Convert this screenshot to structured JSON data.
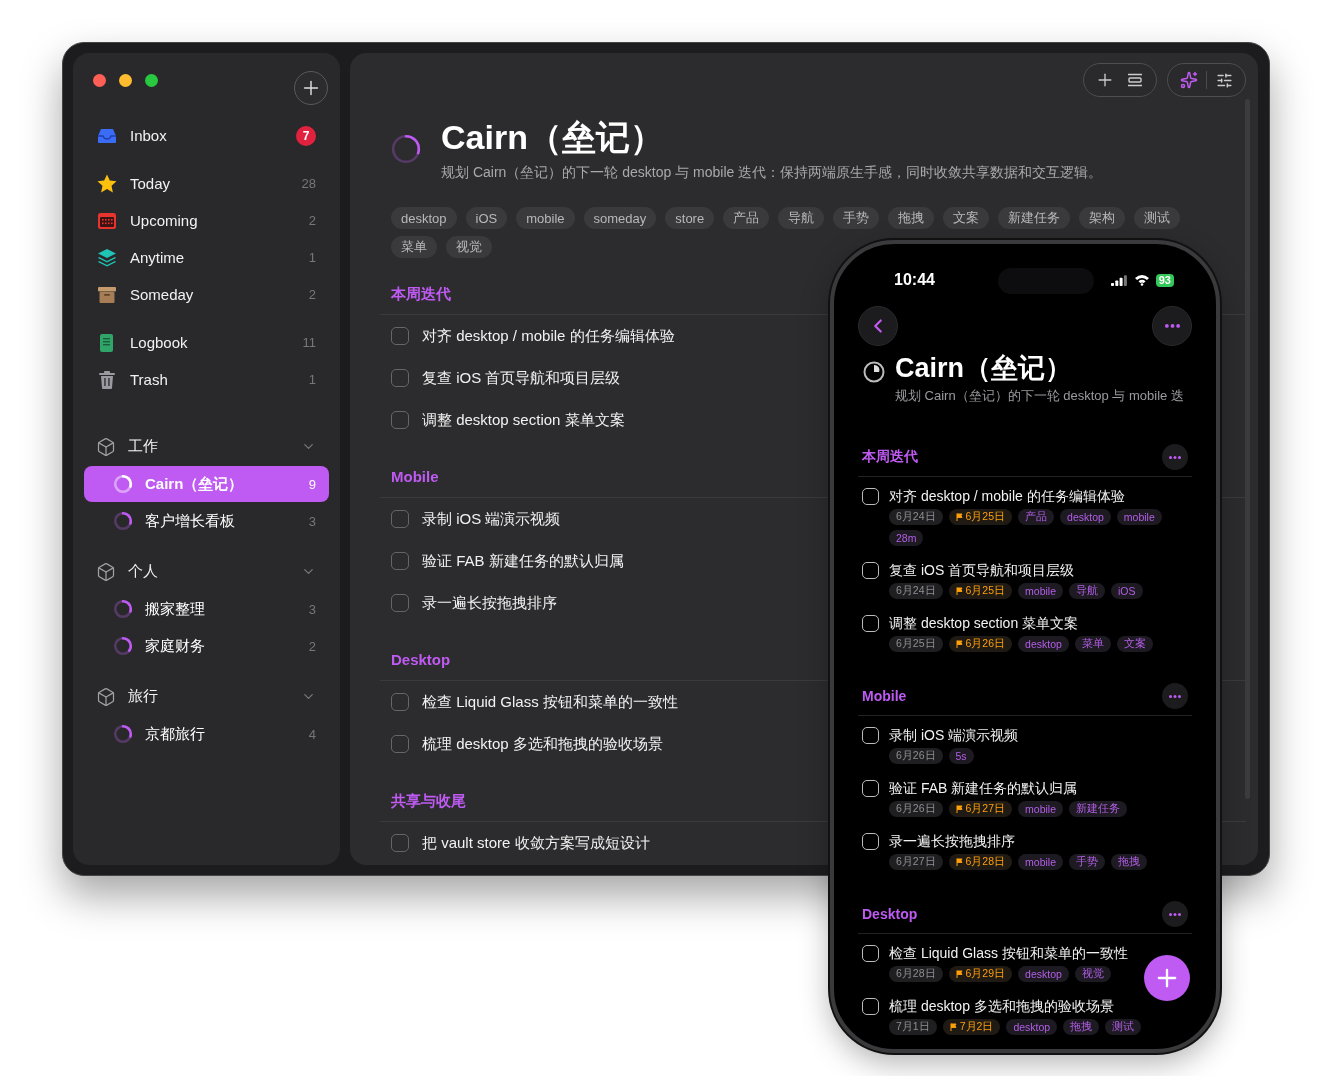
{
  "sidebar": {
    "items": [
      {
        "kind": "inbox",
        "label": "Inbox",
        "count": "7",
        "badge": true
      },
      {
        "kind": "today",
        "label": "Today",
        "count": "28",
        "badge": false
      },
      {
        "kind": "upcoming",
        "label": "Upcoming",
        "count": "2",
        "badge": false
      },
      {
        "kind": "anytime",
        "label": "Anytime",
        "count": "1",
        "badge": false
      },
      {
        "kind": "someday",
        "label": "Someday",
        "count": "2",
        "badge": false
      },
      {
        "kind": "logbook",
        "label": "Logbook",
        "count": "11",
        "badge": false
      },
      {
        "kind": "trash",
        "label": "Trash",
        "count": "1",
        "badge": false
      }
    ],
    "areas": [
      {
        "name": "工作",
        "expanded": true,
        "projects": [
          {
            "name": "Cairn（垒记）",
            "count": "9",
            "selected": true,
            "level": 0.3
          },
          {
            "name": "客户增长看板",
            "count": "3",
            "selected": false,
            "level": 0.3
          }
        ]
      },
      {
        "name": "个人",
        "expanded": true,
        "projects": [
          {
            "name": "搬家整理",
            "count": "3",
            "selected": false,
            "level": 0.3
          },
          {
            "name": "家庭财务",
            "count": "2",
            "selected": false,
            "level": 0.35
          }
        ]
      },
      {
        "name": "旅行",
        "expanded": true,
        "projects": [
          {
            "name": "京都旅行",
            "count": "4",
            "selected": false,
            "level": 0.3
          }
        ]
      }
    ]
  },
  "main": {
    "title": "Cairn（垒记）",
    "level": 0.3,
    "subtitle": "规划 Cairn（垒记）的下一轮 desktop 与 mobile 迭代：保持两端原生手感，同时收敛共享数据和交互逻辑。",
    "tags": [
      "desktop",
      "iOS",
      "mobile",
      "someday",
      "store",
      "产品",
      "导航",
      "手势",
      "拖拽",
      "文案",
      "新建任务",
      "架构",
      "测试",
      "菜单",
      "视觉"
    ],
    "sections": [
      {
        "title": "本周迭代",
        "tasks": [
          {
            "title": "对齐 desktop / mobile 的任务编辑体验",
            "checked": false
          },
          {
            "title": "复查 iOS 首页导航和项目层级",
            "checked": false
          },
          {
            "title": "调整 desktop section 菜单文案",
            "checked": false
          }
        ]
      },
      {
        "title": "Mobile",
        "tasks": [
          {
            "title": "录制 iOS 端演示视频",
            "checked": false
          },
          {
            "title": "验证 FAB 新建任务的默认归属",
            "checked": false
          },
          {
            "title": "录一遍长按拖拽排序",
            "checked": false
          }
        ]
      },
      {
        "title": "Desktop",
        "tasks": [
          {
            "title": "检查 Liquid Glass 按钮和菜单的一致性",
            "checked": false
          },
          {
            "title": "梳理 desktop 多选和拖拽的验收场景",
            "checked": false
          }
        ]
      },
      {
        "title": "共享与收尾",
        "tasks": [
          {
            "title": "把 vault store 收敛方案写成短设计",
            "checked": false
          }
        ]
      }
    ]
  },
  "phone": {
    "time": "10:44",
    "battery": "93",
    "title": "Cairn（垒记）",
    "subtitle": "规划 Cairn（垒记）的下一轮 desktop 与 mobile 迭",
    "sections": [
      {
        "title": "本周迭代",
        "tasks": [
          {
            "title": "对齐 desktop / mobile 的任务编辑体验",
            "checked": false,
            "chips": [
              {
                "kind": "date",
                "text": "6月24日"
              },
              {
                "kind": "deadline",
                "text": "6月25日"
              },
              {
                "kind": "tag",
                "text": "产品"
              },
              {
                "kind": "tag",
                "text": "desktop"
              },
              {
                "kind": "tag",
                "text": "mobile"
              },
              {
                "kind": "duration",
                "text": "28m"
              }
            ]
          },
          {
            "title": "复查 iOS 首页导航和项目层级",
            "checked": false,
            "chips": [
              {
                "kind": "date",
                "text": "6月24日"
              },
              {
                "kind": "deadline",
                "text": "6月25日"
              },
              {
                "kind": "tag",
                "text": "mobile"
              },
              {
                "kind": "tag",
                "text": "导航"
              },
              {
                "kind": "tag",
                "text": "iOS"
              }
            ]
          },
          {
            "title": "调整 desktop section 菜单文案",
            "checked": false,
            "chips": [
              {
                "kind": "date",
                "text": "6月25日"
              },
              {
                "kind": "deadline",
                "text": "6月26日"
              },
              {
                "kind": "tag",
                "text": "desktop"
              },
              {
                "kind": "tag",
                "text": "菜单"
              },
              {
                "kind": "tag",
                "text": "文案"
              }
            ]
          }
        ]
      },
      {
        "title": "Mobile",
        "tasks": [
          {
            "title": "录制 iOS 端演示视频",
            "checked": false,
            "chips": [
              {
                "kind": "date",
                "text": "6月26日"
              },
              {
                "kind": "duration",
                "text": "5s"
              }
            ]
          },
          {
            "title": "验证 FAB 新建任务的默认归属",
            "checked": false,
            "chips": [
              {
                "kind": "date",
                "text": "6月26日"
              },
              {
                "kind": "deadline",
                "text": "6月27日"
              },
              {
                "kind": "tag",
                "text": "mobile"
              },
              {
                "kind": "tag",
                "text": "新建任务"
              }
            ]
          },
          {
            "title": "录一遍长按拖拽排序",
            "checked": false,
            "chips": [
              {
                "kind": "date",
                "text": "6月27日"
              },
              {
                "kind": "deadline",
                "text": "6月28日"
              },
              {
                "kind": "tag",
                "text": "mobile"
              },
              {
                "kind": "tag",
                "text": "手势"
              },
              {
                "kind": "tag",
                "text": "拖拽"
              }
            ]
          }
        ]
      },
      {
        "title": "Desktop",
        "tasks": [
          {
            "title": "检查 Liquid Glass 按钮和菜单的一致性",
            "checked": false,
            "chips": [
              {
                "kind": "date",
                "text": "6月28日"
              },
              {
                "kind": "deadline",
                "text": "6月29日"
              },
              {
                "kind": "tag",
                "text": "desktop"
              },
              {
                "kind": "tag",
                "text": "视觉"
              }
            ]
          },
          {
            "title": "梳理 desktop 多选和拖拽的验收场景",
            "checked": false,
            "chips": [
              {
                "kind": "date",
                "text": "7月1日"
              },
              {
                "kind": "deadline",
                "text": "7月2日"
              },
              {
                "kind": "tag",
                "text": "desktop"
              },
              {
                "kind": "tag",
                "text": "拖拽"
              },
              {
                "kind": "tag",
                "text": "测试"
              }
            ]
          }
        ]
      }
    ]
  }
}
